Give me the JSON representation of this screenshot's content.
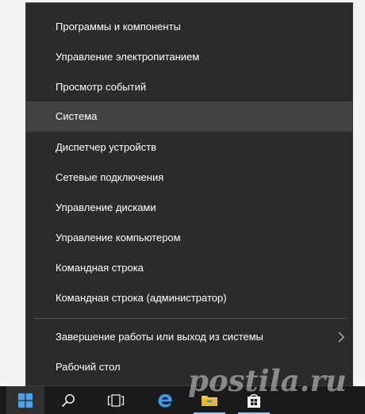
{
  "context_menu": {
    "items": [
      {
        "label": "Программы и компоненты"
      },
      {
        "label": "Управление электропитанием"
      },
      {
        "label": "Просмотр событий"
      },
      {
        "label": "Система",
        "highlighted": true
      },
      {
        "label": "Диспетчер устройств"
      },
      {
        "label": "Сетевые подключения"
      },
      {
        "label": "Управление дисками"
      },
      {
        "label": "Управление компьютером"
      },
      {
        "label": "Командная строка"
      },
      {
        "label": "Командная строка (администратор)"
      },
      {
        "label": "Завершение работы или выход из системы",
        "has_submenu": true
      },
      {
        "label": "Рабочий стол"
      }
    ]
  },
  "taskbar": {
    "buttons": [
      {
        "icon": "windows-start-icon"
      },
      {
        "icon": "search-icon"
      },
      {
        "icon": "task-view-icon"
      },
      {
        "icon": "edge-icon"
      },
      {
        "icon": "file-explorer-icon"
      },
      {
        "icon": "store-icon"
      }
    ]
  },
  "watermark": {
    "text": "postila.ru"
  },
  "colors": {
    "menu_bg": "#2b2b2b",
    "menu_hover": "#424242",
    "taskbar_bg": "#1a1a1a",
    "windows_blue": "#4aa3ea",
    "text": "#ffffff"
  }
}
